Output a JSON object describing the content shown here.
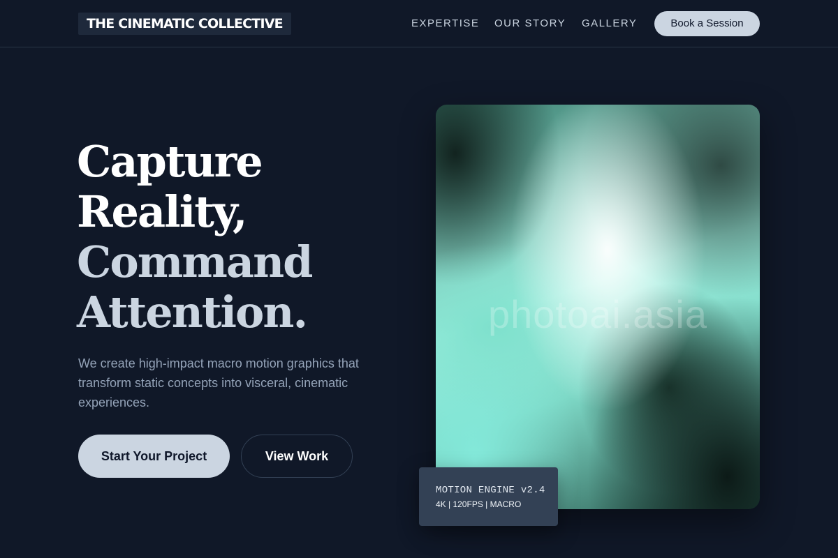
{
  "header": {
    "brand": "THE CINEMATIC COLLECTIVE",
    "nav": [
      "EXPERTISE",
      "OUR STORY",
      "GALLERY"
    ],
    "cta_label": "Book a Session"
  },
  "hero": {
    "headline_line1": "Capture",
    "headline_line2": "Reality,",
    "headline_line3": "Command",
    "headline_line4": "Attention.",
    "description": "We create high-impact macro motion graphics that transform static concepts into visceral, cinematic experiences.",
    "primary_button": "Start Your Project",
    "secondary_button": "View Work"
  },
  "visual": {
    "watermark": "photoai.asia"
  },
  "engine_card": {
    "title": "MOTION ENGINE v2.4",
    "specs": "4K | 120FPS | MACRO"
  },
  "colors": {
    "background": "#101828",
    "accent_button": "#cbd5e1",
    "card": "#334155",
    "visual_mint": "#9ff0e0"
  }
}
